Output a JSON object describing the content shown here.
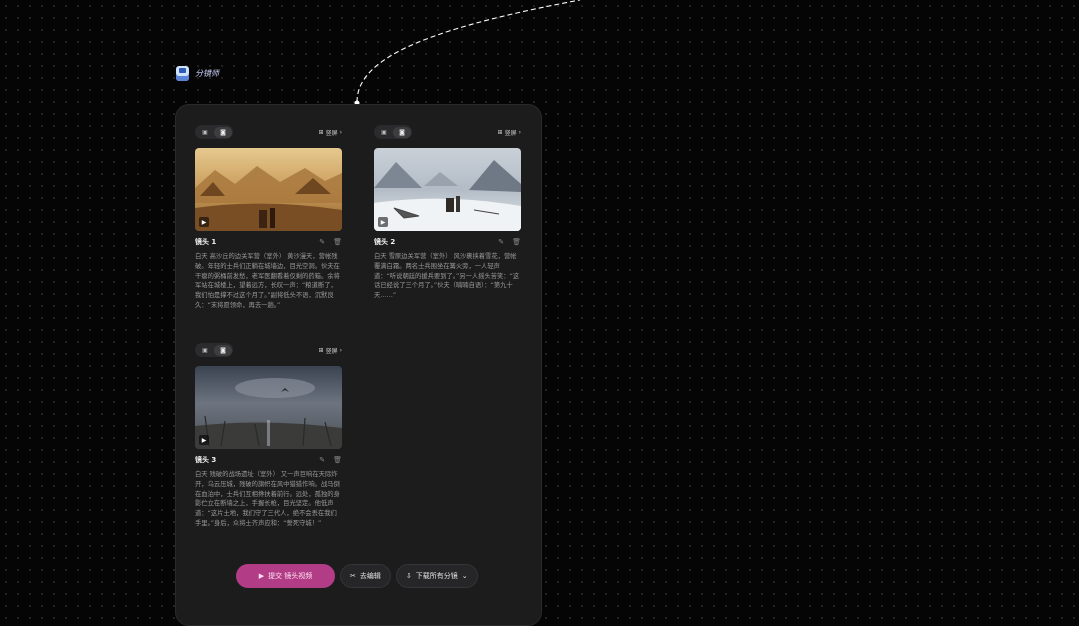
{
  "node": {
    "title": "分镜师",
    "icon": "storyboard-node-icon"
  },
  "toolbar_icons": {
    "image_mode": "image-icon",
    "video_mode": "camera-icon",
    "ratio": "aspect-ratio-icon",
    "chevron": "chevron-right-icon"
  },
  "shots": [
    {
      "ratio_label": "竖屏",
      "title": "镜头 1",
      "description": "白天 高沙丘的边关军营（室外） 黄沙漫天，营帐残破。年轻的士兵们正躺在城墙边，目光空洞。伙夫在干瘪的粥桶前发愁，老军医翻看着仅剩的药箱。余将军站在城楼上，望着远方，长叹一声：“粮道断了，我们怕是撑不过这个月了。”副将低头不语，沉默良久：“末将愿领命，再去一趟。”"
    },
    {
      "ratio_label": "竖屏",
      "title": "镜头 2",
      "description": "白天 雪原边关军营（室外） 风沙裹挟着雪花，营帐覆满白霜。两名士兵围坐在篝火旁，一人轻声道：“听说朝廷的援兵要到了。”另一人摇头苦笑：“这话已经说了三个月了。”伙夫（喃喃自语）：“第九十天……”"
    },
    {
      "ratio_label": "竖屏",
      "title": "镜头 3",
      "description": "白天 残破的战场遗址（室外） 又一声巨响在天际炸开，乌云压城，残破的旗帜在风中猎猎作响。战马倒在血泊中，士兵们互相搀扶着前行。远处，孤独的身影伫立在断墙之上，手握长枪，目光坚定。他低声道：“这片土地，我们守了三代人，绝不会丢在我们手里。”身后，众将士齐声应和：“誓死守城！”"
    }
  ],
  "buttons": {
    "generate_video": "提交 镜头视频",
    "edit": "去编辑",
    "download_all": "下载所有分镜"
  },
  "colors": {
    "primary": "#b23d86",
    "panel": "#1c1c1d",
    "background": "#050505"
  }
}
